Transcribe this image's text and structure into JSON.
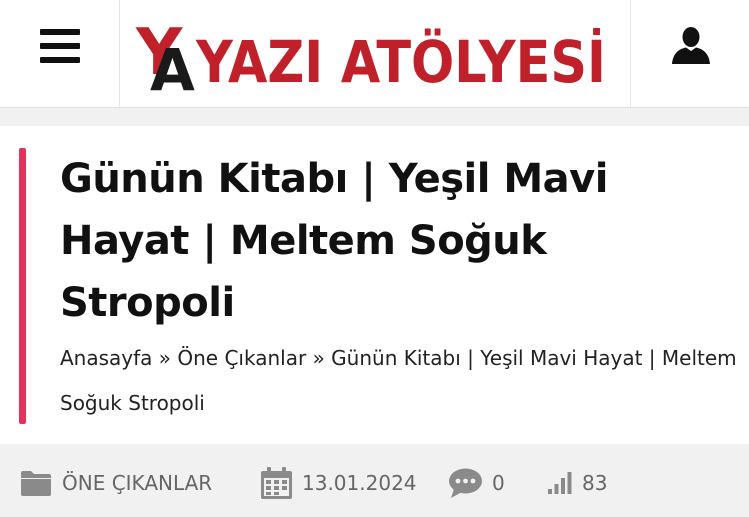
{
  "header": {
    "logo_text": "YAZI ATÖLYESİ",
    "logo_monogram": "YA",
    "menu_icon": "hamburger-menu-icon",
    "user_icon": "user-icon"
  },
  "article": {
    "title": "Günün Kitabı | Yeşil Mavi Hayat | Meltem Soğuk Stropoli",
    "accent_color": "#e3325e",
    "breadcrumb": {
      "home": "Anasayfa",
      "separator": "»",
      "category": "Öne Çıkanlar",
      "current": "Günün Kitabı | Yeşil Mavi Hayat | Meltem Soğuk Stropoli"
    }
  },
  "meta": {
    "category": {
      "icon": "folder-icon",
      "label": "ÖNE ÇIKANLAR"
    },
    "date": {
      "icon": "calendar-icon",
      "value": "13.01.2024"
    },
    "comments": {
      "icon": "comment-icon",
      "value": "0"
    },
    "views": {
      "icon": "signal-bars-icon",
      "value": "83"
    }
  }
}
